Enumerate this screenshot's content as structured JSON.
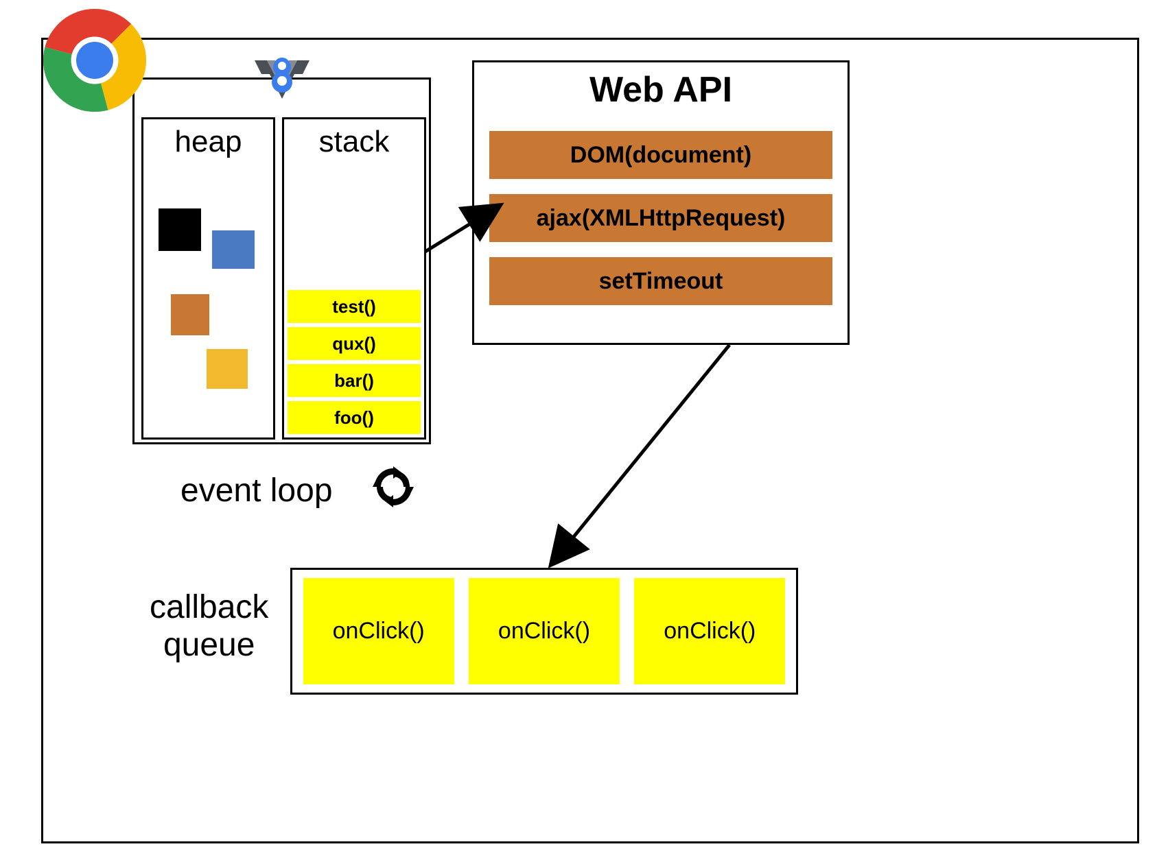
{
  "v8": {
    "heap": {
      "title": "heap",
      "blocks": [
        {
          "color": "#000000"
        },
        {
          "color": "#4a7ac2"
        },
        {
          "color": "#c87833"
        },
        {
          "color": "#f2b92e"
        }
      ]
    },
    "stack": {
      "title": "stack",
      "frames": [
        "test()",
        "qux()",
        "bar()",
        "foo()"
      ]
    }
  },
  "webapi": {
    "title": "Web API",
    "items": [
      "DOM(document)",
      "ajax(XMLHttpRequest)",
      "setTimeout"
    ]
  },
  "event_loop": {
    "label": "event loop"
  },
  "callback_queue": {
    "label_line1": "callback",
    "label_line2": "queue",
    "items": [
      "onClick()",
      "onClick()",
      "onClick()"
    ]
  }
}
